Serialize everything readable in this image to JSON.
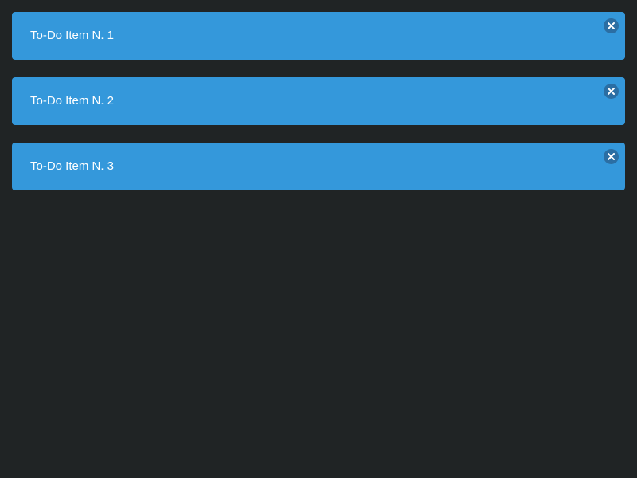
{
  "colors": {
    "background": "#202425",
    "item_background": "#3498db",
    "close_button_background": "#2b6ea3",
    "close_icon": "#ffffff",
    "text": "#ffffff"
  },
  "todos": [
    {
      "label": "To-Do Item N. 1",
      "close_icon": "close-icon"
    },
    {
      "label": "To-Do Item N. 2",
      "close_icon": "close-icon"
    },
    {
      "label": "To-Do Item N. 3",
      "close_icon": "close-icon"
    }
  ]
}
